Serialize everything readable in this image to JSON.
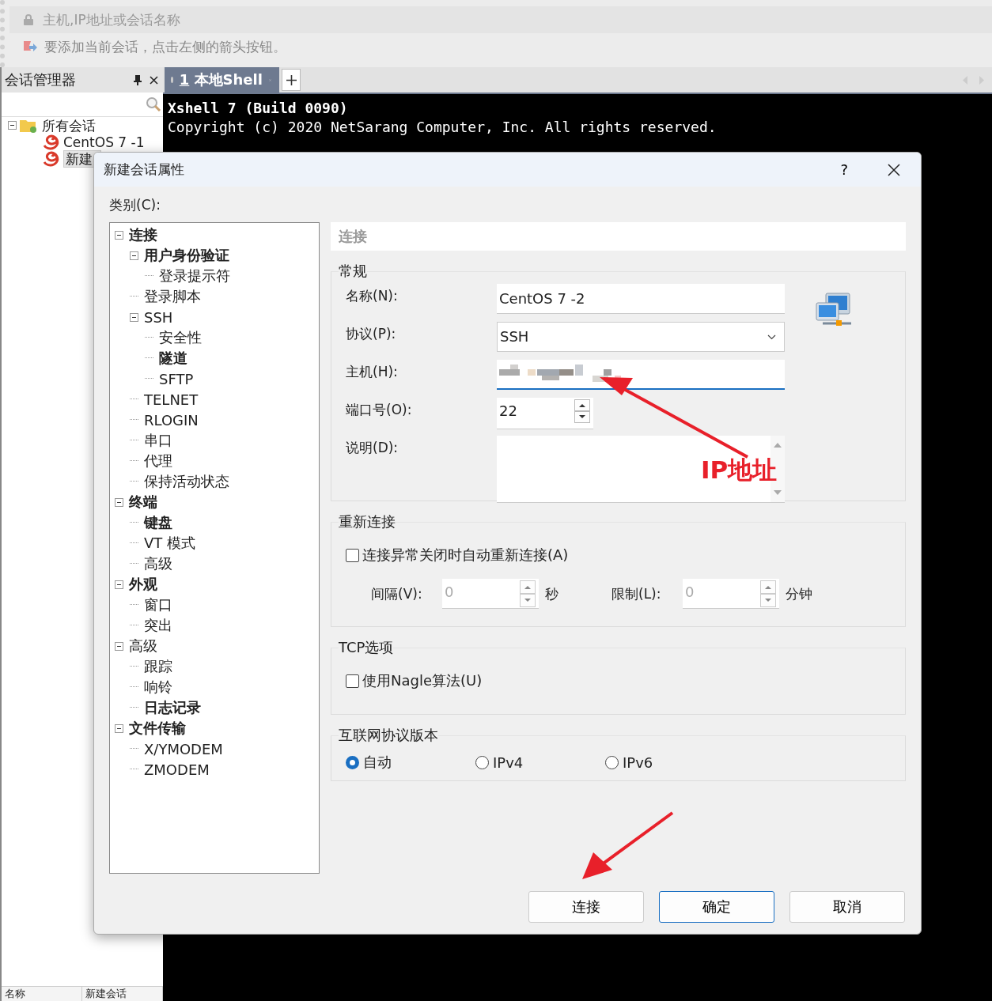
{
  "address_bar": {
    "placeholder": "主机,IP地址或会话名称"
  },
  "hint": "要添加当前会话，点击左侧的箭头按钮。",
  "session_manager": {
    "title": "会话管理器",
    "root": {
      "label": "所有会话",
      "expanded": true,
      "children": [
        {
          "label": "CentOS 7 -1",
          "selected": false
        },
        {
          "label": "新建",
          "selected": true
        }
      ]
    },
    "columns": [
      "名称",
      "新建会话"
    ]
  },
  "tabs": [
    {
      "number": "1",
      "label": "本地Shell",
      "selected": true
    }
  ],
  "terminal": {
    "lines": [
      {
        "text": "Xshell 7 (Build 0090)",
        "bold": true
      },
      {
        "text": "Copyright (c) 2020 NetSarang Computer, Inc. All rights reserved.",
        "bold": false
      }
    ]
  },
  "dialog": {
    "title": "新建会话属性",
    "help": "?",
    "category_label": "类别(C):",
    "categories": [
      {
        "label": "连接",
        "bold": true,
        "expanded": true,
        "children": [
          {
            "label": "用户身份验证",
            "bold": true,
            "expanded": true,
            "children": [
              {
                "label": "登录提示符",
                "bold": false,
                "expanded": false
              }
            ]
          },
          {
            "label": "登录脚本",
            "bold": false,
            "expanded": false
          },
          {
            "label": "SSH",
            "bold": false,
            "expanded": true,
            "children": [
              {
                "label": "安全性",
                "bold": false,
                "expanded": false
              },
              {
                "label": "隧道",
                "bold": true,
                "expanded": false
              },
              {
                "label": "SFTP",
                "bold": false,
                "expanded": false
              }
            ]
          },
          {
            "label": "TELNET",
            "bold": false,
            "expanded": false
          },
          {
            "label": "RLOGIN",
            "bold": false,
            "expanded": false
          },
          {
            "label": "串口",
            "bold": false,
            "expanded": false
          },
          {
            "label": "代理",
            "bold": false,
            "expanded": false
          },
          {
            "label": "保持活动状态",
            "bold": false,
            "expanded": false
          }
        ]
      },
      {
        "label": "终端",
        "bold": true,
        "expanded": true,
        "children": [
          {
            "label": "键盘",
            "bold": true,
            "expanded": false
          },
          {
            "label": "VT 模式",
            "bold": false,
            "expanded": false
          },
          {
            "label": "高级",
            "bold": false,
            "expanded": false
          }
        ]
      },
      {
        "label": "外观",
        "bold": true,
        "expanded": true,
        "children": [
          {
            "label": "窗口",
            "bold": false,
            "expanded": false
          },
          {
            "label": "突出",
            "bold": false,
            "expanded": false
          }
        ]
      },
      {
        "label": "高级",
        "bold": false,
        "expanded": true,
        "children": [
          {
            "label": "跟踪",
            "bold": false,
            "expanded": false
          },
          {
            "label": "响铃",
            "bold": false,
            "expanded": false
          },
          {
            "label": "日志记录",
            "bold": true,
            "expanded": false
          }
        ]
      },
      {
        "label": "文件传输",
        "bold": true,
        "expanded": true,
        "children": [
          {
            "label": "X/YMODEM",
            "bold": false,
            "expanded": false
          },
          {
            "label": "ZMODEM",
            "bold": false,
            "expanded": false
          }
        ]
      }
    ],
    "section_title": "连接",
    "general": {
      "title": "常规",
      "fields": [
        {
          "kind": "text",
          "label": "名称(N):",
          "value": "CentOS 7 -2"
        },
        {
          "kind": "select",
          "label": "协议(P):",
          "value": "SSH"
        },
        {
          "kind": "masked",
          "label": "主机(H):"
        },
        {
          "kind": "spin",
          "label": "端口号(O):",
          "value": "22"
        },
        {
          "kind": "textarea",
          "label": "说明(D):"
        }
      ]
    },
    "reconnect": {
      "title": "重新连接",
      "checkbox": {
        "label": "连接异常关闭时自动重新连接(A)",
        "checked": false
      },
      "interval": {
        "label": "间隔(V):",
        "value": "0",
        "unit": "秒",
        "disabled": true
      },
      "limit": {
        "label": "限制(L):",
        "value": "0",
        "unit": "分钟",
        "disabled": true
      }
    },
    "tcp": {
      "title": "TCP选项",
      "checkbox": {
        "label": "使用Nagle算法(U)",
        "checked": false
      }
    },
    "ip_version": {
      "title": "互联网协议版本",
      "options": [
        {
          "label": "自动",
          "selected": true
        },
        {
          "label": "IPv4",
          "selected": false
        },
        {
          "label": "IPv6",
          "selected": false
        }
      ]
    },
    "buttons": [
      {
        "label": "连接",
        "default": false
      },
      {
        "label": "确定",
        "default": true
      },
      {
        "label": "取消",
        "default": false
      }
    ]
  },
  "annotation": {
    "label": "IP地址"
  }
}
